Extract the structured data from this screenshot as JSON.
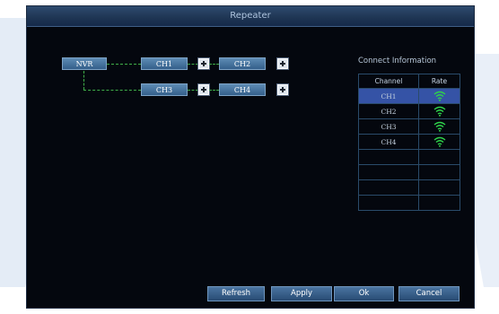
{
  "window": {
    "title": "Repeater"
  },
  "topology": {
    "root": "NVR",
    "nodes": [
      "CH1",
      "CH2",
      "CH3",
      "CH4"
    ]
  },
  "connect_info": {
    "title": "Connect Information",
    "columns": [
      "Channel",
      "Rate"
    ],
    "rows": [
      {
        "channel": "CH1",
        "rate": "wifi-signal-icon",
        "selected": true
      },
      {
        "channel": "CH2",
        "rate": "wifi-signal-icon",
        "selected": false
      },
      {
        "channel": "CH3",
        "rate": "wifi-signal-icon",
        "selected": false
      },
      {
        "channel": "CH4",
        "rate": "wifi-signal-icon",
        "selected": false
      },
      {
        "channel": "",
        "rate": "",
        "selected": false
      },
      {
        "channel": "",
        "rate": "",
        "selected": false
      },
      {
        "channel": "",
        "rate": "",
        "selected": false
      },
      {
        "channel": "",
        "rate": "",
        "selected": false
      }
    ]
  },
  "buttons": {
    "refresh": "Refresh",
    "apply": "Apply",
    "ok": "Ok",
    "cancel": "Cancel"
  },
  "colors": {
    "window_bg": "#04070e",
    "accent": "#345f8a",
    "selected_row": "#3553a6",
    "signal": "#2fd24a"
  }
}
